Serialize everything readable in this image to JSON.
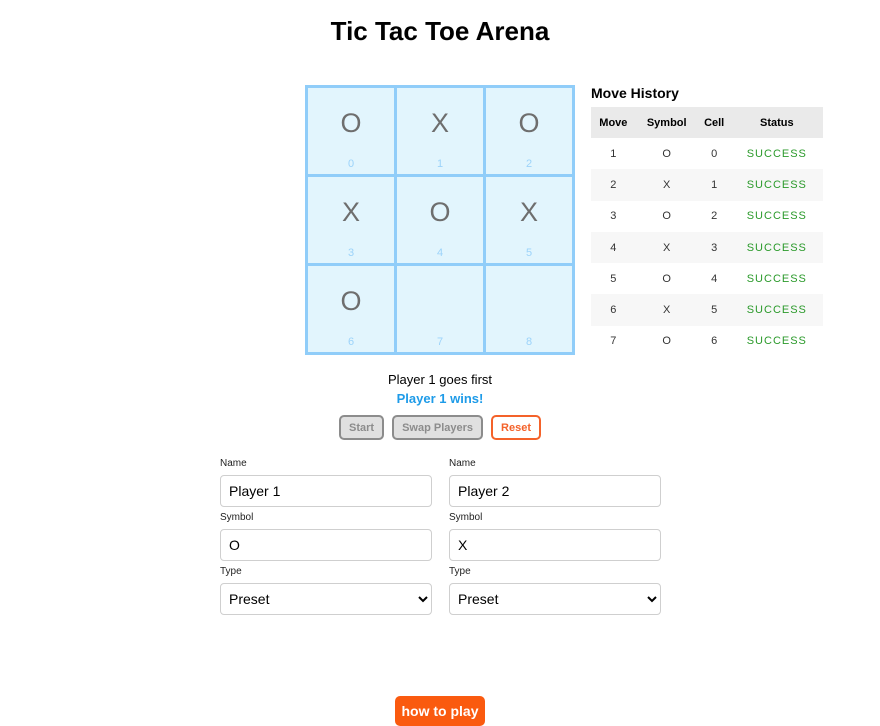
{
  "title": "Tic Tac Toe Arena",
  "board": {
    "cells": [
      {
        "symbol": "O",
        "index": "0"
      },
      {
        "symbol": "X",
        "index": "1"
      },
      {
        "symbol": "O",
        "index": "2"
      },
      {
        "symbol": "X",
        "index": "3"
      },
      {
        "symbol": "O",
        "index": "4"
      },
      {
        "symbol": "X",
        "index": "5"
      },
      {
        "symbol": "O",
        "index": "6"
      },
      {
        "symbol": "",
        "index": "7"
      },
      {
        "symbol": "",
        "index": "8"
      }
    ]
  },
  "history": {
    "title": "Move History",
    "headers": [
      "Move",
      "Symbol",
      "Cell",
      "Status"
    ],
    "rows": [
      {
        "move": "1",
        "symbol": "O",
        "cell": "0",
        "status": "SUCCESS"
      },
      {
        "move": "2",
        "symbol": "X",
        "cell": "1",
        "status": "SUCCESS"
      },
      {
        "move": "3",
        "symbol": "O",
        "cell": "2",
        "status": "SUCCESS"
      },
      {
        "move": "4",
        "symbol": "X",
        "cell": "3",
        "status": "SUCCESS"
      },
      {
        "move": "5",
        "symbol": "O",
        "cell": "4",
        "status": "SUCCESS"
      },
      {
        "move": "6",
        "symbol": "X",
        "cell": "5",
        "status": "SUCCESS"
      },
      {
        "move": "7",
        "symbol": "O",
        "cell": "6",
        "status": "SUCCESS"
      }
    ]
  },
  "status": {
    "first": "Player 1 goes first",
    "result": "Player 1 wins!"
  },
  "buttons": {
    "start": "Start",
    "swap": "Swap Players",
    "reset": "Reset",
    "howto": "how to play"
  },
  "players": [
    {
      "name_label": "Name",
      "name": "Player 1",
      "symbol_label": "Symbol",
      "symbol": "O",
      "type_label": "Type",
      "type": "Preset"
    },
    {
      "name_label": "Name",
      "name": "Player 2",
      "symbol_label": "Symbol",
      "symbol": "X",
      "type_label": "Type",
      "type": "Preset"
    }
  ],
  "colors": {
    "accent": "#fa5a0f",
    "win": "#1e9be8",
    "success": "#2b9a2b",
    "board_border": "#90cdf9"
  }
}
